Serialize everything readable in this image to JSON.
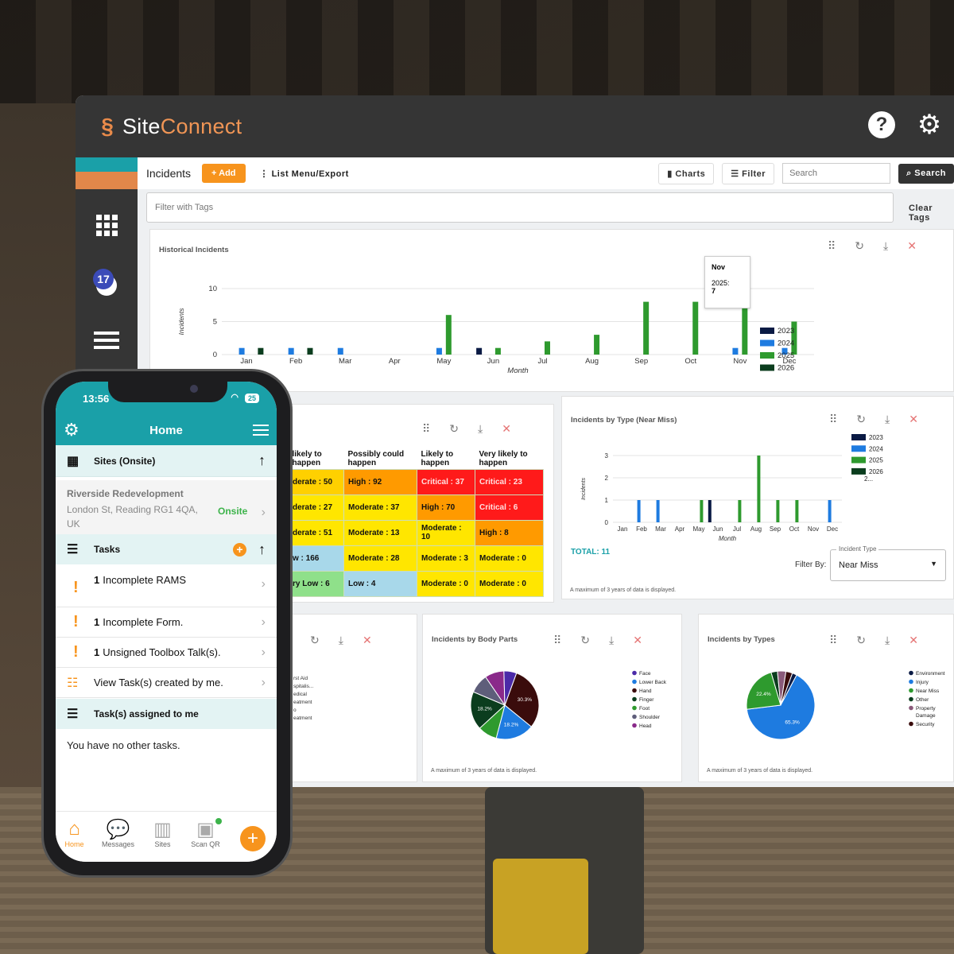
{
  "app": {
    "logo_primary": "Site",
    "logo_secondary": "Connect",
    "rail_badge": "17",
    "brand_colors": {
      "teal": "#1aa0a8",
      "orange": "#f7941d",
      "dark": "#353535"
    }
  },
  "toolbar": {
    "title": "Incidents",
    "add_label": "+ Add",
    "list_menu_label": "⋮ List Menu/Export",
    "charts_label": "Charts",
    "filter_label": "Filter",
    "search_placeholder": "Search",
    "search_label": "Search",
    "tags_placeholder": "Filter with Tags",
    "clear_tags_label": "Clear Tags"
  },
  "historical": {
    "title": "Historical Incidents",
    "tooltip_month": "Nov",
    "tooltip_series": "2025:",
    "tooltip_value": "7"
  },
  "near_miss": {
    "title": "Incidents by Type (Near Miss)",
    "total": "TOTAL: 11",
    "filter_by": "Filter By:",
    "filter_legend": "Incident Type",
    "filter_value": "Near Miss",
    "note": "A maximum of 3 years of data is displayed."
  },
  "risk_matrix": {
    "headers": [
      "likely to\nhappen",
      "Possibly could\nhappen",
      "Likely to\nhappen",
      "Very likely to\nhappen"
    ],
    "rows": [
      [
        {
          "t": "derate : 50",
          "c": "#ffd000"
        },
        {
          "t": "High : 92",
          "c": "#ff9a00"
        },
        {
          "t": "Critical : 37",
          "c": "#ff1a1a"
        },
        {
          "t": "Critical : 23",
          "c": "#ff1a1a"
        }
      ],
      [
        {
          "t": "derate : 27",
          "c": "#ffe600"
        },
        {
          "t": "Moderate : 37",
          "c": "#ffe600"
        },
        {
          "t": "High : 70",
          "c": "#ff9a00"
        },
        {
          "t": "Critical : 6",
          "c": "#ff1a1a"
        }
      ],
      [
        {
          "t": "derate : 51",
          "c": "#ffe600"
        },
        {
          "t": "Moderate : 13",
          "c": "#ffe600"
        },
        {
          "t": "Moderate :\n10",
          "c": "#ffe600"
        },
        {
          "t": "High : 8",
          "c": "#ff9a00"
        }
      ],
      [
        {
          "t": "w : 166",
          "c": "#a8d8ea"
        },
        {
          "t": "Moderate : 28",
          "c": "#ffe600"
        },
        {
          "t": "Moderate : 3",
          "c": "#ffe600"
        },
        {
          "t": "Moderate : 0",
          "c": "#ffe600"
        }
      ],
      [
        {
          "t": "ry Low : 6",
          "c": "#8fe08a"
        },
        {
          "t": "Low : 4",
          "c": "#a8d8ea"
        },
        {
          "t": "Moderate : 0",
          "c": "#ffe600"
        },
        {
          "t": "Moderate : 0",
          "c": "#ffe600"
        }
      ]
    ]
  },
  "treatment": {
    "legend": [
      "rst Aid",
      "spitalis...",
      "edical",
      "eatment",
      "o",
      "eatment"
    ]
  },
  "body_parts": {
    "title": "Incidents by Body Parts",
    "note": "A maximum of 3 years of data is displayed."
  },
  "types": {
    "title": "Incidents by Types",
    "note": "A maximum of 3 years of data is displayed."
  },
  "chart_data": [
    {
      "type": "bar",
      "title": "Historical Incidents",
      "xlabel": "Month",
      "ylabel": "Incidents",
      "categories": [
        "Jan",
        "Feb",
        "Mar",
        "Apr",
        "May",
        "Jun",
        "Jul",
        "Aug",
        "Sep",
        "Oct",
        "Nov",
        "Dec"
      ],
      "ylim": [
        0,
        10
      ],
      "yticks": [
        0,
        5,
        10
      ],
      "legend_position": "right",
      "series": [
        {
          "name": "2023",
          "color": "#0a1a44",
          "values": [
            0,
            0,
            0,
            0,
            0,
            1,
            0,
            0,
            0,
            0,
            0,
            0
          ]
        },
        {
          "name": "2024",
          "color": "#1e7be0",
          "values": [
            1,
            1,
            1,
            0,
            1,
            0,
            0,
            0,
            0,
            0,
            1,
            1
          ]
        },
        {
          "name": "2025",
          "color": "#2e9a2e",
          "values": [
            0,
            0,
            0,
            0,
            6,
            1,
            2,
            3,
            8,
            8,
            7,
            5
          ]
        },
        {
          "name": "2026",
          "color": "#0b3d1e",
          "values": [
            1,
            1,
            0,
            0,
            0,
            0,
            0,
            0,
            0,
            0,
            0,
            0
          ]
        }
      ]
    },
    {
      "type": "bar",
      "title": "Incidents by Type (Near Miss)",
      "xlabel": "Month",
      "ylabel": "Incidents",
      "categories": [
        "Jan",
        "Feb",
        "Mar",
        "Apr",
        "May",
        "Jun",
        "Jul",
        "Aug",
        "Sep",
        "Oct",
        "Nov",
        "Dec"
      ],
      "ylim": [
        0,
        3
      ],
      "yticks": [
        0,
        1,
        2,
        3
      ],
      "legend_position": "top-right",
      "legend_overflow": "2...",
      "series": [
        {
          "name": "2023",
          "color": "#0a1a44",
          "values": [
            0,
            0,
            0,
            0,
            0,
            1,
            0,
            0,
            0,
            0,
            0,
            0
          ]
        },
        {
          "name": "2024",
          "color": "#1e7be0",
          "values": [
            0,
            1,
            1,
            0,
            0,
            0,
            0,
            0,
            0,
            0,
            0,
            1
          ]
        },
        {
          "name": "2025",
          "color": "#2e9a2e",
          "values": [
            0,
            0,
            0,
            0,
            1,
            0,
            1,
            3,
            1,
            1,
            0,
            0
          ]
        },
        {
          "name": "2026",
          "color": "#0b3d1e",
          "values": [
            0,
            0,
            0,
            0,
            0,
            0,
            0,
            0,
            0,
            0,
            0,
            0
          ]
        }
      ]
    },
    {
      "type": "pie",
      "title": "Incidents by Body Parts",
      "legend_position": "right",
      "labels": [
        "Hand",
        "Lower Back",
        "Foot",
        "Finger",
        "Shoulder",
        "Head",
        "Face"
      ],
      "values": [
        30.3,
        18.2,
        9.1,
        18.2,
        9.1,
        9.1,
        6.0
      ],
      "slice_labels": [
        "30.3%",
        "18.2%",
        "",
        "18.2%",
        "",
        "",
        ""
      ],
      "label_order": [
        6,
        1,
        0,
        3,
        2,
        4,
        5
      ],
      "colors": [
        "#3a0c0c",
        "#1e7be0",
        "#2e9a2e",
        "#0b3d1e",
        "#5e5e7a",
        "#8a2a8a",
        "#4b2aa8"
      ]
    },
    {
      "type": "pie",
      "title": "Incidents by Types",
      "legend_position": "right",
      "labels": [
        "Environment",
        "Injury",
        "Near Miss",
        "Other",
        "Property Damage",
        "Security"
      ],
      "values": [
        2.2,
        65.3,
        22.4,
        3.0,
        4.0,
        3.1
      ],
      "slice_labels": [
        "",
        "65.3%",
        "22.4%",
        "",
        "",
        ""
      ],
      "colors": [
        "#0a1a44",
        "#1e7be0",
        "#2e9a2e",
        "#0b3d1e",
        "#8a5a7a",
        "#3a0c0c"
      ]
    }
  ],
  "phone": {
    "time": "13:56",
    "battery": "25",
    "header": "Home",
    "sites_section": "Sites (Onsite)",
    "site_name": "Riverside Redevelopment",
    "site_address": "London St, Reading RG1 4QA, UK",
    "site_status": "Onsite",
    "tasks_section": "Tasks",
    "tasks": [
      {
        "count": "1",
        "label": "Incomplete RAMS"
      },
      {
        "count": "1",
        "label": "Incomplete Form."
      },
      {
        "count": "1",
        "label": "Unsigned Toolbox Talk(s)."
      }
    ],
    "view_tasks": "View Task(s) created by me.",
    "assigned_section": "Task(s) assigned to me",
    "empty_message": "You have no other tasks.",
    "tabs": [
      "Home",
      "Messages",
      "Sites",
      "Scan QR"
    ]
  }
}
